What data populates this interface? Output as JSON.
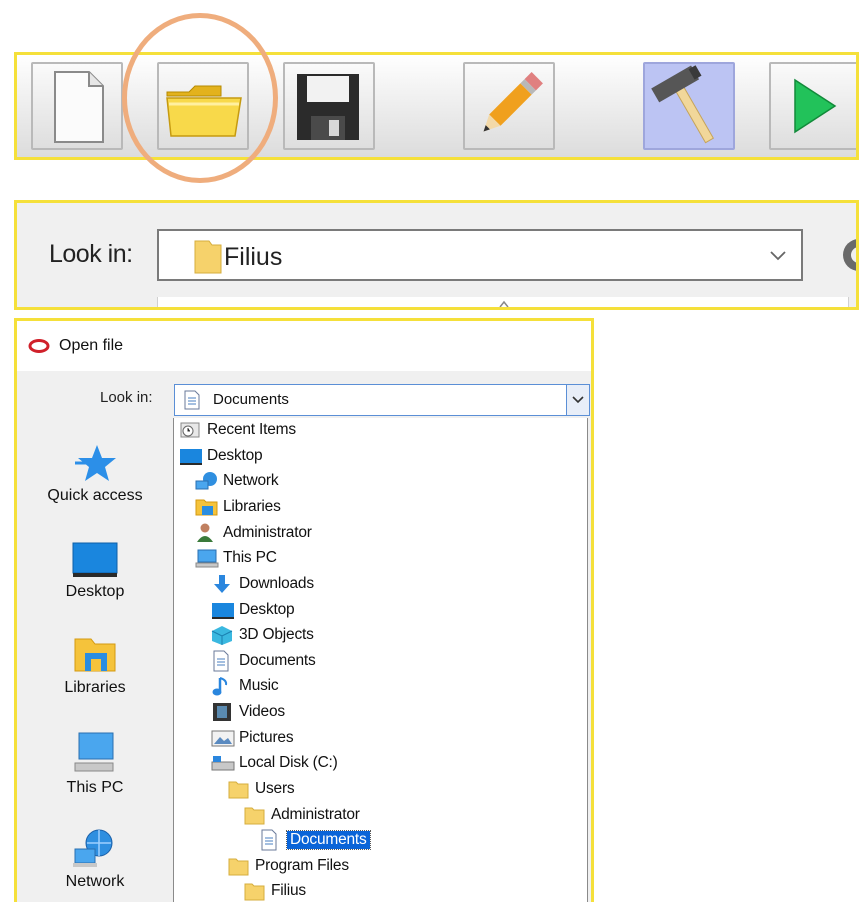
{
  "toolbar": {
    "buttons": [
      {
        "name": "new-file",
        "icon": "blank-page-icon"
      },
      {
        "name": "open-file",
        "icon": "folder-icon",
        "highlighted": true
      },
      {
        "name": "save-file",
        "icon": "floppy-disk-icon"
      },
      {
        "name": "edit",
        "icon": "pencil-icon"
      },
      {
        "name": "build",
        "icon": "hammer-icon",
        "active": true
      },
      {
        "name": "run",
        "icon": "play-icon"
      }
    ],
    "highlight_color": "#efad7d"
  },
  "zoomed_lookin": {
    "label": "Look in:",
    "value": "Filius"
  },
  "dialog": {
    "title": "Open file",
    "lookin_label": "Look in:",
    "lookin_value": "Documents",
    "places": [
      {
        "label": "Quick access",
        "icon": "star-icon"
      },
      {
        "label": "Desktop",
        "icon": "desktop-icon"
      },
      {
        "label": "Libraries",
        "icon": "libraries-icon"
      },
      {
        "label": "This PC",
        "icon": "computer-icon"
      },
      {
        "label": "Network",
        "icon": "network-icon"
      }
    ],
    "tree": [
      {
        "label": "Recent Items",
        "icon": "recent-items-icon"
      },
      {
        "label": "Desktop",
        "icon": "desktop-icon"
      },
      {
        "label": "Network",
        "icon": "network-icon"
      },
      {
        "label": "Libraries",
        "icon": "libraries-icon"
      },
      {
        "label": "Administrator",
        "icon": "user-icon"
      },
      {
        "label": "This PC",
        "icon": "computer-icon"
      },
      {
        "label": "Downloads",
        "icon": "download-arrow-icon"
      },
      {
        "label": "Desktop",
        "icon": "desktop-icon"
      },
      {
        "label": "3D Objects",
        "icon": "cube-icon"
      },
      {
        "label": "Documents",
        "icon": "document-icon"
      },
      {
        "label": "Music",
        "icon": "music-note-icon"
      },
      {
        "label": "Videos",
        "icon": "film-icon"
      },
      {
        "label": "Pictures",
        "icon": "picture-icon"
      },
      {
        "label": "Local Disk (C:)",
        "icon": "drive-icon"
      },
      {
        "label": "Users",
        "icon": "folder-icon"
      },
      {
        "label": "Administrator",
        "icon": "folder-icon"
      },
      {
        "label": "Documents",
        "icon": "document-icon",
        "selected": true
      },
      {
        "label": "Program Files",
        "icon": "folder-icon"
      },
      {
        "label": "Filius",
        "icon": "folder-icon"
      }
    ]
  },
  "colors": {
    "panel_border": "#f5e03a",
    "selection": "#0a64d8",
    "active_button": "#bcc4f3"
  }
}
